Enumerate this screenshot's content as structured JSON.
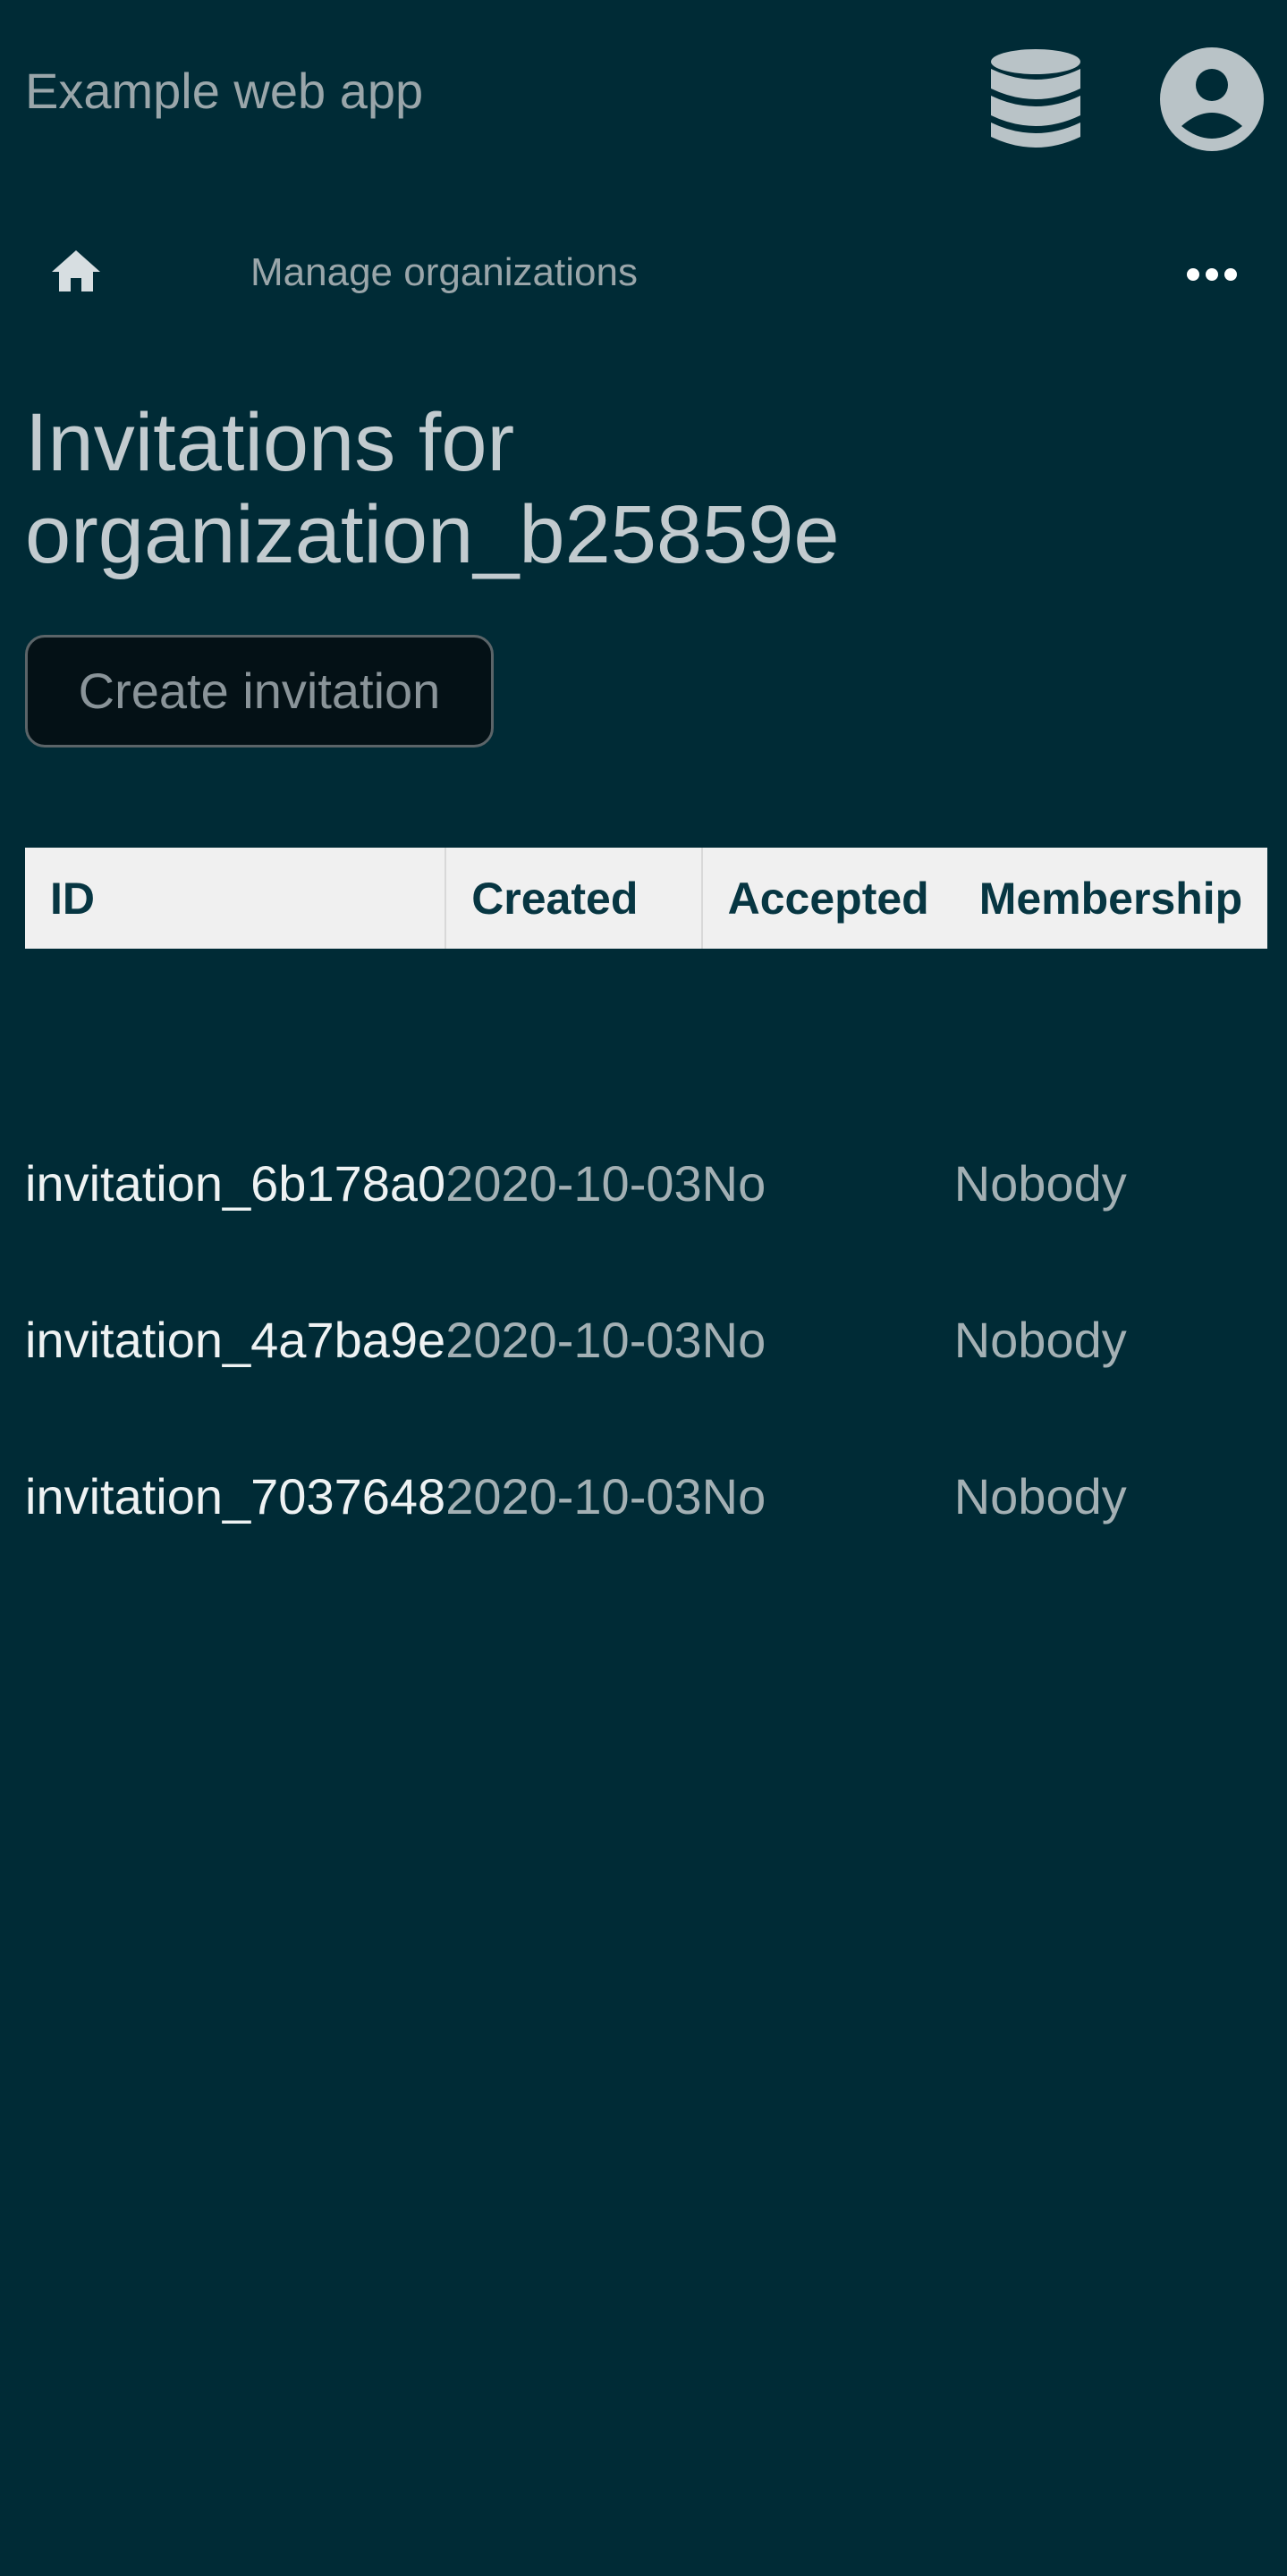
{
  "header": {
    "app_title": "Example web app",
    "database_icon": "database-icon",
    "account_icon": "user-circle-icon"
  },
  "nav": {
    "home_icon": "home-icon",
    "manage_link": "Manage organizations",
    "more_icon": "more-horizontal-icon"
  },
  "page": {
    "title": "Invitations for organization_b25859e",
    "create_button_label": "Create invitation"
  },
  "table": {
    "columns": [
      "ID",
      "Created",
      "Accepted",
      "Membership"
    ],
    "rows": [
      {
        "id": "invitation_6b178a0",
        "created": "2020-10-03",
        "accepted": "No",
        "membership": "Nobody"
      },
      {
        "id": "invitation_4a7ba9e",
        "created": "2020-10-03",
        "accepted": "No",
        "membership": "Nobody"
      },
      {
        "id": "invitation_7037648",
        "created": "2020-10-03",
        "accepted": "No",
        "membership": "Nobody"
      }
    ]
  },
  "colors": {
    "background": "#002b36",
    "text": "#c2cbcf",
    "header_bg": "#f0f0f0",
    "header_text": "#073642"
  }
}
